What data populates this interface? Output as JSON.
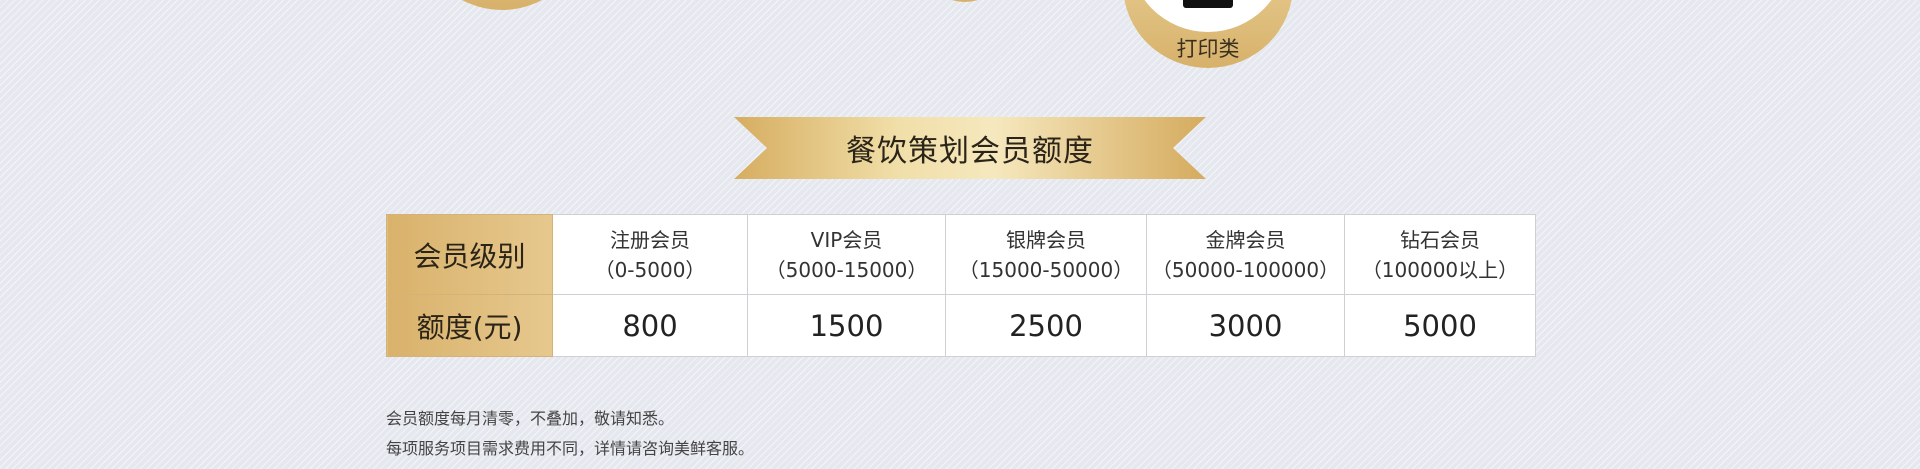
{
  "badges": {
    "print_label": "打印类"
  },
  "banner": {
    "title": "餐饮策划会员额度"
  },
  "table": {
    "row_headers": {
      "level": "会员级别",
      "amount": "额度(元)"
    },
    "tiers": [
      {
        "name": "注册会员",
        "range": "（0-5000）",
        "amount": "800"
      },
      {
        "name": "VIP会员",
        "range": "（5000-15000）",
        "amount": "1500"
      },
      {
        "name": "银牌会员",
        "range": "（15000-50000）",
        "amount": "2500"
      },
      {
        "name": "金牌会员",
        "range": "（50000-100000）",
        "amount": "3000"
      },
      {
        "name": "钻石会员",
        "range": "（100000以上）",
        "amount": "5000"
      }
    ]
  },
  "notes": [
    "会员额度每月清零，不叠加，敬请知悉。",
    "每项服务项目需求费用不同，详情请咨询美鲜客服。"
  ],
  "colors": {
    "gold_light": "#f1dfa9",
    "gold_dark": "#d6ad60",
    "background": "#e6e8ef"
  }
}
